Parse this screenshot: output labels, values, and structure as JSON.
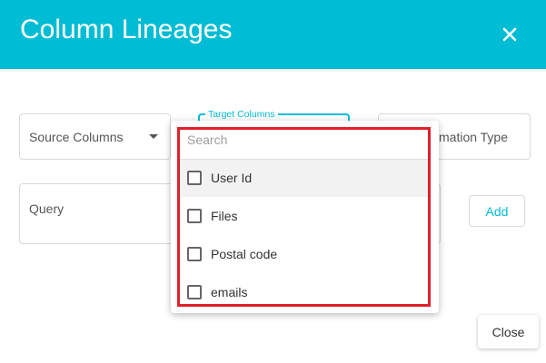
{
  "dialog": {
    "title": "Column Lineages",
    "close_icon": "close-icon"
  },
  "form": {
    "source_columns_label": "Source Columns",
    "target_columns_label": "Target Columns",
    "transformation_type_label": "mation Type",
    "query_placeholder": "Query",
    "add_label": "Add",
    "close_label": "Close"
  },
  "dropdown": {
    "search_placeholder": "Search",
    "options": [
      {
        "label": "User Id",
        "checked": false
      },
      {
        "label": "Files",
        "checked": false
      },
      {
        "label": "Postal code",
        "checked": false
      },
      {
        "label": "emails",
        "checked": false
      }
    ]
  },
  "colors": {
    "header": "#00bcd4",
    "accent": "#00bcd4",
    "highlight_border": "#e0202a"
  }
}
